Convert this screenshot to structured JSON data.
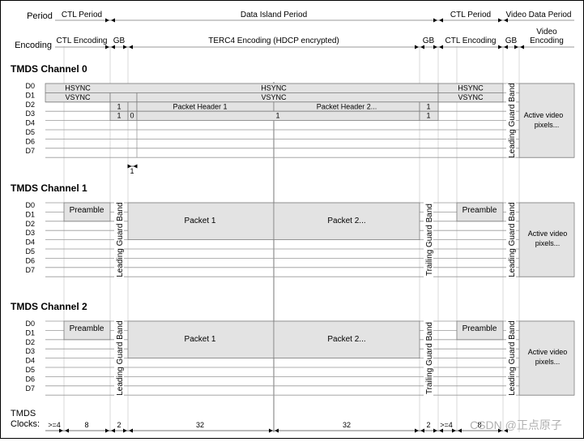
{
  "header": {
    "period_label": "Period",
    "encoding_label": "Encoding",
    "periods": [
      "CTL Period",
      "Data Island Period",
      "CTL Period",
      "Video Data Period"
    ],
    "encodings": [
      "CTL Encoding",
      "GB",
      "TERC4 Encoding (HDCP encrypted)",
      "GB",
      "CTL Encoding",
      "GB",
      "Video",
      "Encoding"
    ]
  },
  "rows": [
    "D0",
    "D1",
    "D2",
    "D3",
    "D4",
    "D5",
    "D6",
    "D7"
  ],
  "channel0": {
    "title": "TMDS Channel 0",
    "hsync": "HSYNC",
    "vsync": "VSYNC",
    "d2_values": [
      "1",
      "Packet Header 1",
      "Packet Header 2...",
      "1"
    ],
    "d3_values": [
      "1",
      "0",
      "1",
      "1"
    ],
    "guard_band": "Leading Guard Band",
    "active_video": [
      "Active video",
      "pixels..."
    ],
    "marker": "1"
  },
  "channel1": {
    "title": "TMDS Channel 1",
    "preamble": "Preamble",
    "leading_guard": "Leading Guard Band",
    "packet1": "Packet 1",
    "packet2": "Packet 2...",
    "trailing_guard": "Trailing Guard Band",
    "preamble2": "Preamble",
    "leading_guard2": "Leading Guard Band",
    "active_video": [
      "Active video",
      "pixels..."
    ]
  },
  "channel2": {
    "title": "TMDS Channel 2",
    "preamble": "Preamble",
    "leading_guard": "Leading Guard Band",
    "packet1": "Packet 1",
    "packet2": "Packet 2...",
    "trailing_guard": "Trailing Guard Band",
    "preamble2": "Preamble",
    "leading_guard2": "Leading Guard Band",
    "active_video": [
      "Active video",
      "pixels..."
    ]
  },
  "clocks": {
    "label1": "TMDS",
    "label2": "Clocks:",
    "values": [
      ">=4",
      "8",
      "2",
      "32",
      "32",
      "2",
      ">=4",
      "8"
    ]
  },
  "watermark": "CSDN @正点原子",
  "colors": {
    "fill": "#e3e3e3",
    "line": "#7f7f7f",
    "guide": "#d0d0d0"
  }
}
